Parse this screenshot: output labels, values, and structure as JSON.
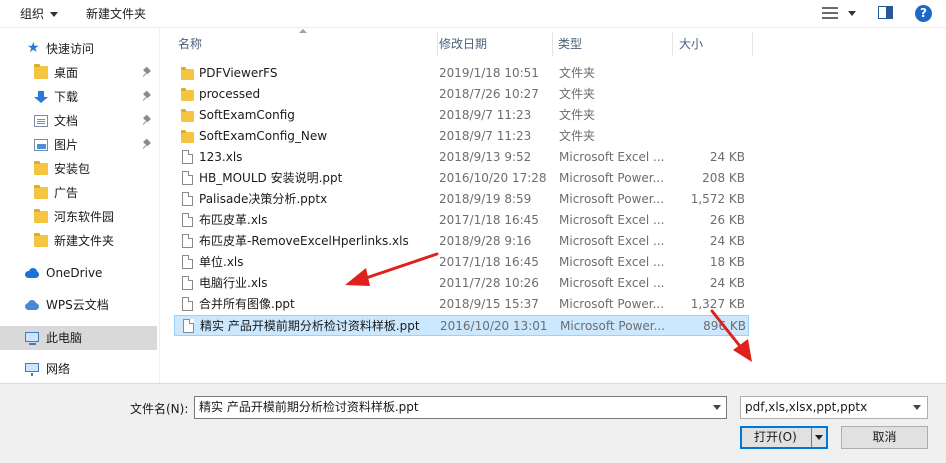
{
  "toolbar": {
    "organize_label": "组织",
    "new_folder_label": "新建文件夹",
    "icons": [
      "view-options-icon",
      "preview-pane-icon",
      "help-icon"
    ]
  },
  "sidebar": {
    "items": [
      {
        "label": "快速访问",
        "icon": "star-icon",
        "pinned": false
      },
      {
        "label": "桌面",
        "icon": "desktop-icon",
        "pinned": true
      },
      {
        "label": "下载",
        "icon": "download-icon",
        "pinned": true
      },
      {
        "label": "文档",
        "icon": "document-icon",
        "pinned": true
      },
      {
        "label": "图片",
        "icon": "picture-icon",
        "pinned": true
      },
      {
        "label": "安装包",
        "icon": "folder-icon",
        "pinned": false
      },
      {
        "label": "广告",
        "icon": "folder-icon",
        "pinned": false
      },
      {
        "label": "河东软件园",
        "icon": "folder-icon",
        "pinned": false
      },
      {
        "label": "新建文件夹",
        "icon": "folder-icon",
        "pinned": false
      },
      {
        "label": "OneDrive",
        "icon": "onedrive-icon",
        "pinned": false
      },
      {
        "label": "WPS云文档",
        "icon": "wps-cloud-icon",
        "pinned": false
      },
      {
        "label": "此电脑",
        "icon": "computer-icon",
        "pinned": false,
        "selected": true
      },
      {
        "label": "网络",
        "icon": "network-icon",
        "pinned": false
      }
    ]
  },
  "columns": {
    "name": "名称",
    "date": "修改日期",
    "type": "类型",
    "size": "大小"
  },
  "files": [
    {
      "name": "PDFViewerFS",
      "date": "2019/1/18 10:51",
      "type": "文件夹",
      "size": "",
      "kind": "folder"
    },
    {
      "name": "processed",
      "date": "2018/7/26 10:27",
      "type": "文件夹",
      "size": "",
      "kind": "folder"
    },
    {
      "name": "SoftExamConfig",
      "date": "2018/9/7 11:23",
      "type": "文件夹",
      "size": "",
      "kind": "folder"
    },
    {
      "name": "SoftExamConfig_New",
      "date": "2018/9/7 11:23",
      "type": "文件夹",
      "size": "",
      "kind": "folder"
    },
    {
      "name": "123.xls",
      "date": "2018/9/13 9:52",
      "type": "Microsoft Excel ...",
      "size": "24 KB",
      "kind": "file"
    },
    {
      "name": "HB_MOULD 安装说明.ppt",
      "date": "2016/10/20 17:28",
      "type": "Microsoft Power...",
      "size": "208 KB",
      "kind": "file"
    },
    {
      "name": "Palisade决策分析.pptx",
      "date": "2018/9/19 8:59",
      "type": "Microsoft Power...",
      "size": "1,572 KB",
      "kind": "file"
    },
    {
      "name": "布匹皮革.xls",
      "date": "2017/1/18 16:45",
      "type": "Microsoft Excel ...",
      "size": "26 KB",
      "kind": "file"
    },
    {
      "name": "布匹皮革-RemoveExcelHperlinks.xls",
      "date": "2018/9/28 9:16",
      "type": "Microsoft Excel ...",
      "size": "24 KB",
      "kind": "file"
    },
    {
      "name": "单位.xls",
      "date": "2017/1/18 16:45",
      "type": "Microsoft Excel ...",
      "size": "18 KB",
      "kind": "file"
    },
    {
      "name": "电脑行业.xls",
      "date": "2011/7/28 10:26",
      "type": "Microsoft Excel ...",
      "size": "24 KB",
      "kind": "file"
    },
    {
      "name": "合并所有图像.ppt",
      "date": "2018/9/15 15:37",
      "type": "Microsoft Power...",
      "size": "1,327 KB",
      "kind": "file"
    },
    {
      "name": "精实  产品开模前期分析检讨资料样板.ppt",
      "date": "2016/10/20 13:01",
      "type": "Microsoft Power...",
      "size": "896 KB",
      "kind": "file",
      "selected": true
    }
  ],
  "footer": {
    "filename_label": "文件名(N):",
    "filename_value": "精实  产品开模前期分析检讨资料样板.ppt",
    "filter_value": "pdf,xls,xlsx,ppt,pptx",
    "open_label": "打开(O)",
    "cancel_label": "取消"
  },
  "colors": {
    "selection_bg": "#cce8ff",
    "selection_border": "#99d1ff",
    "folder": "#f5c542",
    "annotation_arrow": "#e0201b",
    "accent": "#0078d7"
  }
}
